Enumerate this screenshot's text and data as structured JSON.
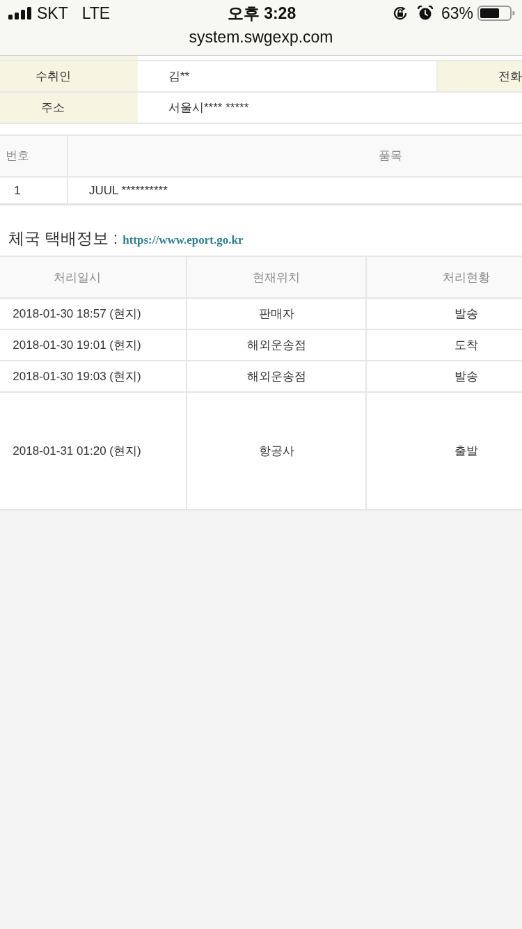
{
  "status_bar": {
    "carrier": "SKT",
    "network": "LTE",
    "time": "오후 3:28",
    "battery": "63%"
  },
  "address_bar": {
    "url": "system.swgexp.com"
  },
  "recipient_table": {
    "rows": [
      {
        "label": "수취인",
        "value": "김**",
        "extra_label": "전화"
      },
      {
        "label": "주소",
        "value": "서울시**** *****"
      }
    ]
  },
  "items_table": {
    "columns": [
      "번호",
      "품목"
    ],
    "rows": [
      [
        "1",
        "JUUL **********"
      ]
    ]
  },
  "tracking": {
    "heading": "체국 택배정보 :",
    "link": "https://www.eport.go.kr",
    "columns": [
      "처리일시",
      "현재위치",
      "처리현황"
    ],
    "rows": [
      {
        "datetime": "2018-01-30 18:57 (현지)",
        "location": "판매자",
        "status": "발송"
      },
      {
        "datetime": "2018-01-30 19:01 (현지)",
        "location": "해외운송점",
        "status": "도착"
      },
      {
        "datetime": "2018-01-30 19:03 (현지)",
        "location": "해외운송점",
        "status": "발송"
      },
      {
        "datetime": "2018-01-31 01:20 (현지)",
        "location": "항공사",
        "status": "출발"
      }
    ]
  }
}
